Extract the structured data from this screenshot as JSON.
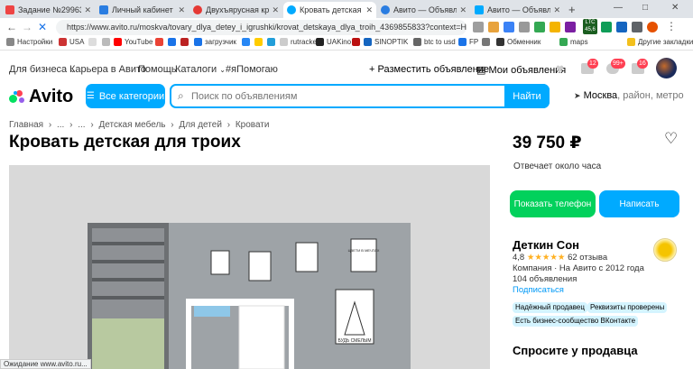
{
  "browser": {
    "tabs": [
      {
        "title": "Задание №2996322 - а",
        "color": "#e44"
      },
      {
        "title": "Личный кабинет - Обу",
        "color": "#2a7de1"
      },
      {
        "title": "Двухъярусная кроват",
        "color": "#e53935"
      },
      {
        "title": "Кровать детская для тр",
        "color": "#00aaff",
        "active": true
      },
      {
        "title": "Авито — Объявления",
        "color": "#2a7de1"
      },
      {
        "title": "Авито — Объявления",
        "color": "#00aaff"
      }
    ],
    "new_tab": "+",
    "url": "https://www.avito.ru/moskva/tovary_dlya_detey_i_igrushki/krovat_detskaya_dlya_troih_4369855833?context=H4sIAAAAAA",
    "back": "←",
    "forward": "→",
    "stop": "✕",
    "bookmarks": [
      {
        "label": "Настройки",
        "color": "#888"
      },
      {
        "label": "USA",
        "color": "#c33"
      },
      {
        "label": "",
        "color": "#ddd"
      },
      {
        "label": "YouTube",
        "color": "#f00"
      },
      {
        "label": "",
        "color": "#ea4335"
      },
      {
        "label": "",
        "color": "#1a73e8"
      },
      {
        "label": "",
        "color": "#b22"
      },
      {
        "label": "загрузчик",
        "color": "#1a73e8"
      },
      {
        "label": "",
        "color": "#2787f5"
      },
      {
        "label": "",
        "color": "#ffcc00"
      },
      {
        "label": "",
        "color": "#229ed9"
      },
      {
        "label": "rutracker",
        "color": "#ccc"
      },
      {
        "label": "UAKino",
        "color": "#222"
      },
      {
        "label": "",
        "color": "#b11"
      },
      {
        "label": "SINOPTIK",
        "color": "#1565c0"
      },
      {
        "label": "btc to usd",
        "color": "#666"
      },
      {
        "label": "FP",
        "color": "#1a73e8"
      },
      {
        "label": "",
        "color": "#777"
      },
      {
        "label": "Обменник",
        "color": "#333"
      },
      {
        "label": "maps",
        "color": "#34a853"
      },
      {
        "label": "Другие закладки",
        "color": "#f3c01d"
      }
    ],
    "ext_ltc": "LTC",
    "ext_ltc_value": "45,6",
    "status_text": "Ожидание www.avito.ru..."
  },
  "header": {
    "links": [
      "Для бизнеса",
      "Карьера в Авито",
      "Помощь",
      "Каталоги",
      "#яПомогаю"
    ],
    "post_ad": "Разместить объявление",
    "my_ads": "Мои объявления",
    "badges": [
      "12",
      "99+",
      "16"
    ],
    "logo_text": "Avito",
    "categories_button": "Все категории",
    "search_placeholder": "Поиск по объявлениям",
    "search_button": "Найти",
    "region_city": "Москва",
    "region_rest": ", район, метро"
  },
  "breadcrumbs": [
    "Главная",
    "›",
    "...",
    "›",
    "...",
    "›",
    "Детская мебель",
    "›",
    "Для детей",
    "›",
    "Кровати"
  ],
  "listing": {
    "title": "Кровать детская для троих",
    "price": "39 750 ₽",
    "answers": "Отвечает около часа",
    "phone_button": "Показать телефон",
    "write_button": "Написать"
  },
  "seller": {
    "name": "Деткин Сон",
    "rating": "4,8",
    "stars": "★★★★★",
    "reviews": "62 отзыва",
    "company": "Компания · На Авито с 2012 года",
    "ads_count": "104 объявления",
    "subscribe": "Подписаться",
    "chips": [
      "Надёжный продавец",
      "Реквизиты проверены",
      "Есть бизнес-сообщество ВКонтакте"
    ],
    "ask_title": "Спросите у продавца"
  },
  "photo": {
    "poster_texts": [
      "ЦВЕТИ В МЕЧТАХ",
      "БУДЬ СМЕЛЫМ"
    ]
  },
  "colors": {
    "accent": "#00aaff",
    "green": "#02d15c",
    "badge": "#ff4053",
    "chip": "#d4f4ff"
  }
}
